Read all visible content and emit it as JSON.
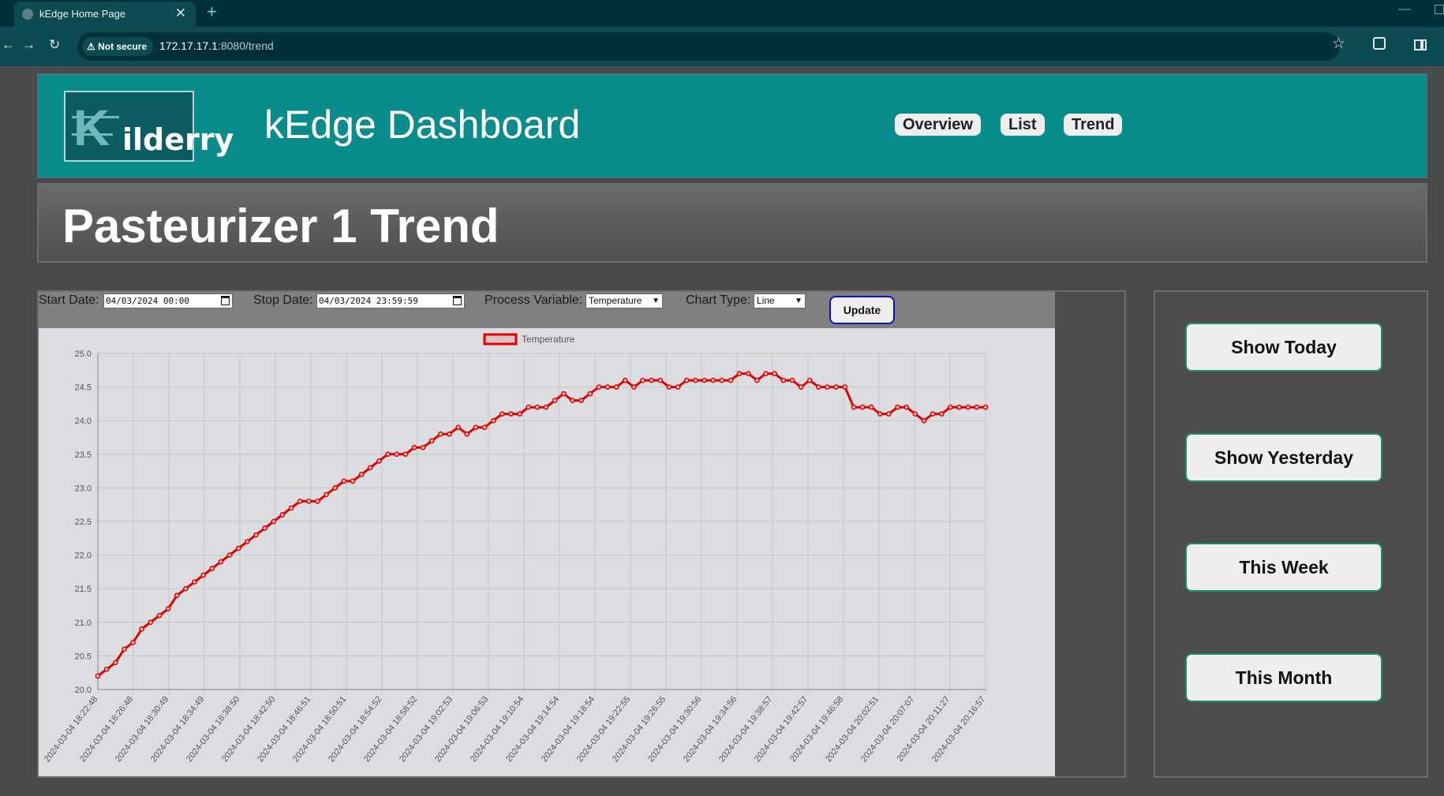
{
  "browser": {
    "tab_title": "kEdge Home Page",
    "new_tab_symbol": "+",
    "security_label": "Not secure",
    "url_host": "172.17.17.1",
    "url_rest": ":8080/trend"
  },
  "header": {
    "logo_text": "ilderry",
    "logo_letter": "K",
    "title": "kEdge Dashboard",
    "nav": [
      {
        "label": "Overview"
      },
      {
        "label": "List"
      },
      {
        "label": "Trend"
      }
    ]
  },
  "page": {
    "title": "Pasteurizer 1 Trend"
  },
  "controls": {
    "start_label": "Start Date:",
    "start_value": "04/03/2024 00:00",
    "stop_label": "Stop Date:",
    "stop_value": "04/03/2024 23:59:59",
    "pv_label": "Process Variable:",
    "pv_value": "Temperature",
    "chart_type_label": "Chart Type:",
    "chart_type_value": "Line",
    "update_label": "Update"
  },
  "quick_buttons": [
    {
      "label": "Show Today"
    },
    {
      "label": "Show Yesterday"
    },
    {
      "label": "This Week"
    },
    {
      "label": "This Month"
    }
  ],
  "colors": {
    "header_bg": "#0b8c8c",
    "series": "#e00000",
    "chart_bg": "#dcdde0",
    "button_border": "#1c8e6f"
  },
  "chart_data": {
    "type": "line",
    "title": "",
    "xlabel": "",
    "ylabel": "",
    "ylim": [
      20.0,
      25.0
    ],
    "yticks": [
      "20.0",
      "20.5",
      "21.0",
      "21.5",
      "22.0",
      "22.5",
      "23.0",
      "23.5",
      "24.0",
      "24.5",
      "25.0"
    ],
    "grid": true,
    "legend": "top-center",
    "x_tick_labels": [
      "2024-03-04 18:22:48",
      "2024-03-04 18:26:48",
      "2024-03-04 18:30:49",
      "2024-03-04 18:34:49",
      "2024-03-04 18:38:50",
      "2024-03-04 18:42:50",
      "2024-03-04 18:46:51",
      "2024-03-04 18:50:51",
      "2024-03-04 18:54:52",
      "2024-03-04 18:58:52",
      "2024-03-04 19:02:53",
      "2024-03-04 19:06:53",
      "2024-03-04 19:10:54",
      "2024-03-04 19:14:54",
      "2024-03-04 19:18:54",
      "2024-03-04 19:22:55",
      "2024-03-04 19:26:55",
      "2024-03-04 19:30:56",
      "2024-03-04 19:34:56",
      "2024-03-04 19:38:57",
      "2024-03-04 19:42:57",
      "2024-03-04 19:46:58",
      "2024-03-04 20:02:51",
      "2024-03-04 20:07:07",
      "2024-03-04 20:11:27",
      "2024-03-04 20:16:57"
    ],
    "series": [
      {
        "name": "Temperature",
        "values": [
          20.2,
          20.3,
          20.4,
          20.6,
          20.7,
          20.9,
          21.0,
          21.1,
          21.2,
          21.4,
          21.5,
          21.6,
          21.7,
          21.8,
          21.9,
          22.0,
          22.1,
          22.2,
          22.3,
          22.4,
          22.5,
          22.6,
          22.7,
          22.8,
          22.8,
          22.8,
          22.9,
          23.0,
          23.1,
          23.1,
          23.2,
          23.3,
          23.4,
          23.5,
          23.5,
          23.5,
          23.6,
          23.6,
          23.7,
          23.8,
          23.8,
          23.9,
          23.8,
          23.9,
          23.9,
          24.0,
          24.1,
          24.1,
          24.1,
          24.2,
          24.2,
          24.2,
          24.3,
          24.4,
          24.3,
          24.3,
          24.4,
          24.5,
          24.5,
          24.5,
          24.6,
          24.5,
          24.6,
          24.6,
          24.6,
          24.5,
          24.5,
          24.6,
          24.6,
          24.6,
          24.6,
          24.6,
          24.6,
          24.7,
          24.7,
          24.6,
          24.7,
          24.7,
          24.6,
          24.6,
          24.5,
          24.6,
          24.5,
          24.5,
          24.5,
          24.5,
          24.2,
          24.2,
          24.2,
          24.1,
          24.1,
          24.2,
          24.2,
          24.1,
          24.0,
          24.1,
          24.1,
          24.2,
          24.2,
          24.2,
          24.2,
          24.2
        ]
      }
    ]
  }
}
